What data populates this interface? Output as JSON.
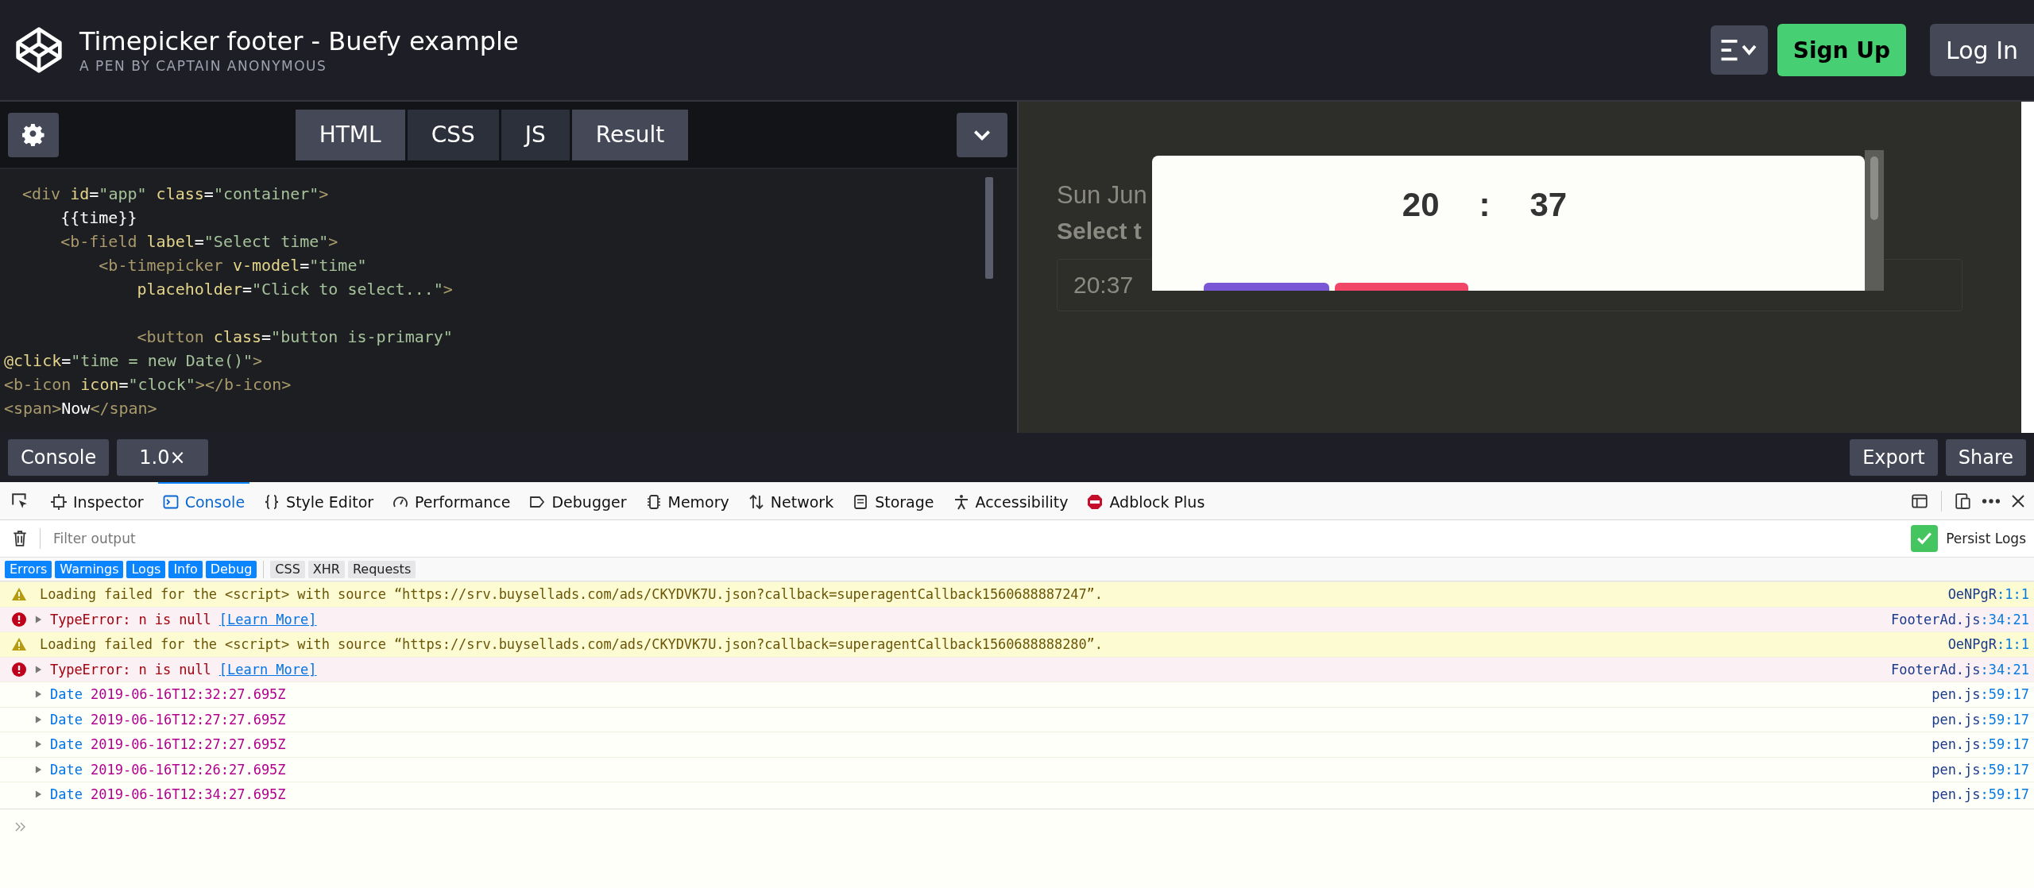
{
  "header": {
    "title": "Timepicker footer - Buefy example",
    "subtitle": "A PEN BY CAPTAIN ANONYMOUS",
    "sign_up": "Sign Up",
    "log_in": "Log In"
  },
  "editor_tabs": [
    {
      "label": "HTML",
      "selected": true
    },
    {
      "label": "CSS",
      "selected": false
    },
    {
      "label": "JS",
      "selected": false
    },
    {
      "label": "Result",
      "selected": true
    }
  ],
  "code_lines": [
    {
      "segments": [
        {
          "kind": "tag",
          "text": "<div "
        },
        {
          "kind": "attr",
          "text": "id"
        },
        {
          "kind": "op",
          "text": "="
        },
        {
          "kind": "str",
          "text": "\"app\" "
        },
        {
          "kind": "attr",
          "text": "class"
        },
        {
          "kind": "op",
          "text": "="
        },
        {
          "kind": "str",
          "text": "\"container\""
        },
        {
          "kind": "tag",
          "text": ">"
        }
      ]
    },
    {
      "segments": [
        {
          "kind": "text",
          "text": "    {{time}}"
        }
      ]
    },
    {
      "segments": [
        {
          "kind": "tag",
          "text": "    <b-field "
        },
        {
          "kind": "attr",
          "text": "label"
        },
        {
          "kind": "op",
          "text": "="
        },
        {
          "kind": "str",
          "text": "\"Select time\""
        },
        {
          "kind": "tag",
          "text": ">"
        }
      ]
    },
    {
      "segments": [
        {
          "kind": "tag",
          "text": "        <b-timepicker "
        },
        {
          "kind": "attr",
          "text": "v-model"
        },
        {
          "kind": "op",
          "text": "="
        },
        {
          "kind": "str",
          "text": "\"time\""
        }
      ]
    },
    {
      "segments": [
        {
          "kind": "attr",
          "text": "            placeholder"
        },
        {
          "kind": "op",
          "text": "="
        },
        {
          "kind": "str",
          "text": "\"Click to select...\""
        },
        {
          "kind": "tag",
          "text": ">"
        }
      ]
    },
    {
      "gap_before": true,
      "segments": [
        {
          "kind": "tag",
          "text": "            <button "
        },
        {
          "kind": "attr",
          "text": "class"
        },
        {
          "kind": "op",
          "text": "="
        },
        {
          "kind": "str",
          "text": "\"button is-primary\""
        }
      ]
    },
    {
      "segments": [
        {
          "kind": "attr",
          "text": "@click"
        },
        {
          "kind": "op",
          "text": "="
        },
        {
          "kind": "str",
          "text": "\"time = new Date()\""
        },
        {
          "kind": "tag",
          "text": ">"
        }
      ]
    },
    {
      "segments": [
        {
          "kind": "tag",
          "text": "<b-icon "
        },
        {
          "kind": "attr",
          "text": "icon"
        },
        {
          "kind": "op",
          "text": "="
        },
        {
          "kind": "str",
          "text": "\"clock\""
        },
        {
          "kind": "tag",
          "text": "></b-icon>"
        }
      ]
    },
    {
      "segments": [
        {
          "kind": "tag",
          "text": "<span>"
        },
        {
          "kind": "text",
          "text": "Now"
        },
        {
          "kind": "tag",
          "text": "</span>"
        }
      ]
    }
  ],
  "result": {
    "date_text": "Sun Jun",
    "label": "Select t",
    "input_value": "20:37",
    "modal": {
      "hours": "20",
      "separator": ":",
      "minutes": "37"
    }
  },
  "console_bar": {
    "left": [
      "Console",
      "1.0×"
    ],
    "right": [
      "Export",
      "Share"
    ]
  },
  "devtools_tabs": [
    {
      "kind": "pick"
    },
    {
      "kind": "inspector",
      "label": "Inspector",
      "selected": false
    },
    {
      "kind": "console",
      "label": "Console",
      "selected": true
    },
    {
      "kind": "style",
      "label": "Style Editor",
      "selected": false
    },
    {
      "kind": "performance",
      "label": "Performance",
      "selected": false
    },
    {
      "kind": "debugger",
      "label": "Debugger",
      "selected": false
    },
    {
      "kind": "memory",
      "label": "Memory",
      "selected": false
    },
    {
      "kind": "network",
      "label": "Network",
      "selected": false
    },
    {
      "kind": "storage",
      "label": "Storage",
      "selected": false
    },
    {
      "kind": "accessibility",
      "label": "Accessibility",
      "selected": false
    },
    {
      "kind": "adblock",
      "label": "Adblock Plus",
      "selected": false
    }
  ],
  "filter": {
    "placeholder": "Filter output",
    "persist_logs": {
      "label": "Persist Logs",
      "checked": true
    }
  },
  "filter_buttons": [
    {
      "label": "Errors",
      "selected": true
    },
    {
      "label": "Warnings",
      "selected": true
    },
    {
      "label": "Logs",
      "selected": true
    },
    {
      "label": "Info",
      "selected": true
    },
    {
      "label": "Debug",
      "selected": true
    },
    {
      "label": "CSS",
      "selected": false
    },
    {
      "label": "XHR",
      "selected": false
    },
    {
      "label": "Requests",
      "selected": false
    }
  ],
  "messages": [
    {
      "kind": "warning",
      "text": "Loading failed for the <script> with source “https://srv.buysellads.com/ads/CKYDVK7U.json?callback=superagentCallback1560688887247”.",
      "file": "OeNPgR",
      "position": ":1:1"
    },
    {
      "kind": "error",
      "text": "TypeError: n is null",
      "link": "[Learn More]",
      "file": "FooterAd.js",
      "position": ":34:21"
    },
    {
      "kind": "warning",
      "text": "Loading failed for the <script> with source “https://srv.buysellads.com/ads/CKYDVK7U.json?callback=superagentCallback1560688888280”.",
      "file": "OeNPgR",
      "position": ":1:1"
    },
    {
      "kind": "error",
      "text": "TypeError: n is null",
      "link": "[Learn More]",
      "file": "FooterAd.js",
      "position": ":34:21"
    },
    {
      "kind": "log",
      "label": "Date",
      "text": "2019-06-16T12:32:27.695Z",
      "file": "pen.js",
      "position": ":59:17"
    },
    {
      "kind": "log",
      "label": "Date",
      "text": "2019-06-16T12:27:27.695Z",
      "file": "pen.js",
      "position": ":59:17"
    },
    {
      "kind": "log",
      "label": "Date",
      "text": "2019-06-16T12:27:27.695Z",
      "file": "pen.js",
      "position": ":59:17"
    },
    {
      "kind": "log",
      "label": "Date",
      "text": "2019-06-16T12:26:27.695Z",
      "file": "pen.js",
      "position": ":59:17"
    },
    {
      "kind": "log",
      "label": "Date",
      "text": "2019-06-16T12:34:27.695Z",
      "file": "pen.js",
      "position": ":59:17"
    }
  ]
}
